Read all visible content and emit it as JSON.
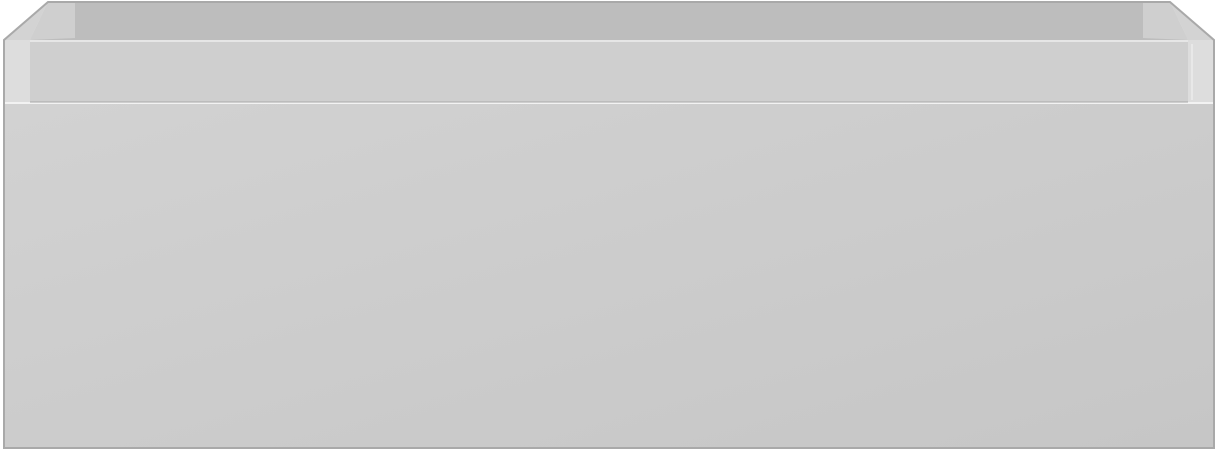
{
  "object": {
    "colors": {
      "back_panel": "#bdbdbd",
      "rim_face": "#cfcfcf",
      "rim_top_edge": "#e6e6e6",
      "side_post_light": "#dddddd",
      "side_post_mid": "#d3d3d3",
      "front_face_top": "#d2d2d2",
      "front_face_bottom": "#c6c6c6",
      "outline": "#a9a9a9",
      "highlight": "#f2f2f2"
    }
  }
}
